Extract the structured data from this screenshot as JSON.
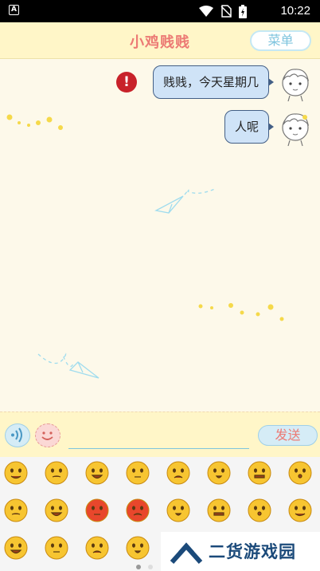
{
  "status": {
    "indicator": "A",
    "time": "10:22",
    "icons": [
      "wifi-icon",
      "no-sim-icon",
      "battery-charging-icon"
    ]
  },
  "header": {
    "title": "小鸡贱贱",
    "menu_label": "菜单"
  },
  "messages": [
    {
      "text": "贱贱，今天星期几",
      "failed": true
    },
    {
      "text": "人呢",
      "failed": false
    }
  ],
  "error_glyph": "!",
  "composer": {
    "input_value": "",
    "send_label": "发送"
  },
  "emoji_panel": {
    "rows": 3,
    "columns": 8,
    "page_count": 2,
    "current_page": 1
  },
  "watermark": {
    "text": "二货游戏园"
  },
  "colors": {
    "accent_pink": "#ec7a74",
    "accent_blue": "#7ec4de",
    "bubble": "#cfe3f7",
    "header_bg": "#fff6c8"
  }
}
